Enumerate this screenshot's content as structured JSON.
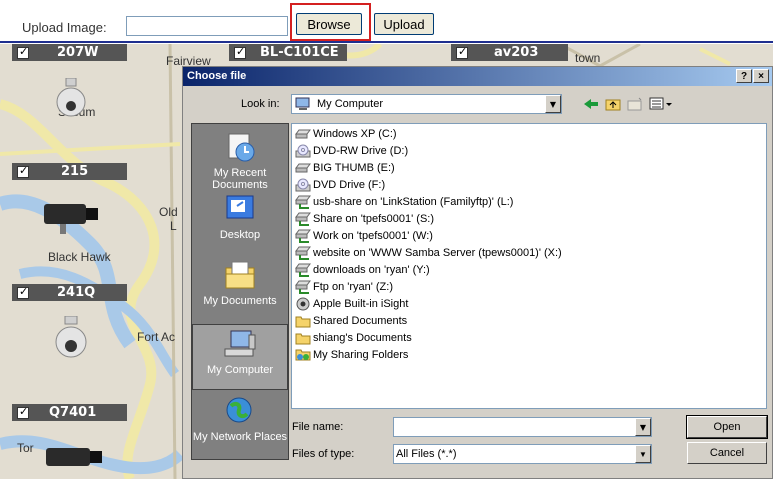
{
  "upload": {
    "label": "Upload Image:",
    "browse_label": "Browse",
    "upload_label": "Upload"
  },
  "map": {
    "labels": [
      "Fairview",
      "town",
      "Sacum",
      "Old",
      "L",
      "Black Hawk",
      "Fort Ac",
      "Tor"
    ]
  },
  "cameras": [
    {
      "name": "207W"
    },
    {
      "name": "BL-C101CE"
    },
    {
      "name": "av203"
    },
    {
      "name": "215"
    },
    {
      "name": "241Q"
    },
    {
      "name": "Q7401"
    }
  ],
  "dialog": {
    "title": "Choose file",
    "help": "?",
    "close": "×",
    "look_in_label": "Look in:",
    "look_in_value": "My Computer",
    "places": [
      {
        "label": "My Recent Documents",
        "icon": "recent-documents-icon"
      },
      {
        "label": "Desktop",
        "icon": "desktop-icon"
      },
      {
        "label": "My Documents",
        "icon": "my-documents-icon"
      },
      {
        "label": "My Computer",
        "icon": "my-computer-icon"
      },
      {
        "label": "My Network Places",
        "icon": "network-places-icon"
      }
    ],
    "files": [
      {
        "name": "Windows XP (C:)",
        "icon": "hard-drive-icon"
      },
      {
        "name": "DVD-RW Drive (D:)",
        "icon": "dvd-drive-icon"
      },
      {
        "name": "BIG THUMB (E:)",
        "icon": "hard-drive-icon"
      },
      {
        "name": "DVD Drive (F:)",
        "icon": "dvd-drive-icon"
      },
      {
        "name": "usb-share on 'LinkStation (Familyftp)' (L:)",
        "icon": "network-drive-icon"
      },
      {
        "name": "Share on 'tpefs0001' (S:)",
        "icon": "network-drive-icon"
      },
      {
        "name": "Work on 'tpefs0001' (W:)",
        "icon": "network-drive-icon"
      },
      {
        "name": "website on 'WWW Samba Server (tpews0001)' (X:)",
        "icon": "network-drive-icon"
      },
      {
        "name": "downloads on 'ryan' (Y:)",
        "icon": "network-drive-icon"
      },
      {
        "name": "Ftp on 'ryan' (Z:)",
        "icon": "network-drive-icon"
      },
      {
        "name": "Apple Built-in iSight",
        "icon": "camera-device-icon"
      },
      {
        "name": "Shared Documents",
        "icon": "folder-icon"
      },
      {
        "name": "shiang's Documents",
        "icon": "folder-icon"
      },
      {
        "name": "My Sharing Folders",
        "icon": "sharing-folder-icon"
      }
    ],
    "file_name_label": "File name:",
    "file_name_value": "",
    "files_of_type_label": "Files of type:",
    "files_of_type_value": "All Files (*.*)",
    "open_label": "Open",
    "cancel_label": "Cancel"
  }
}
